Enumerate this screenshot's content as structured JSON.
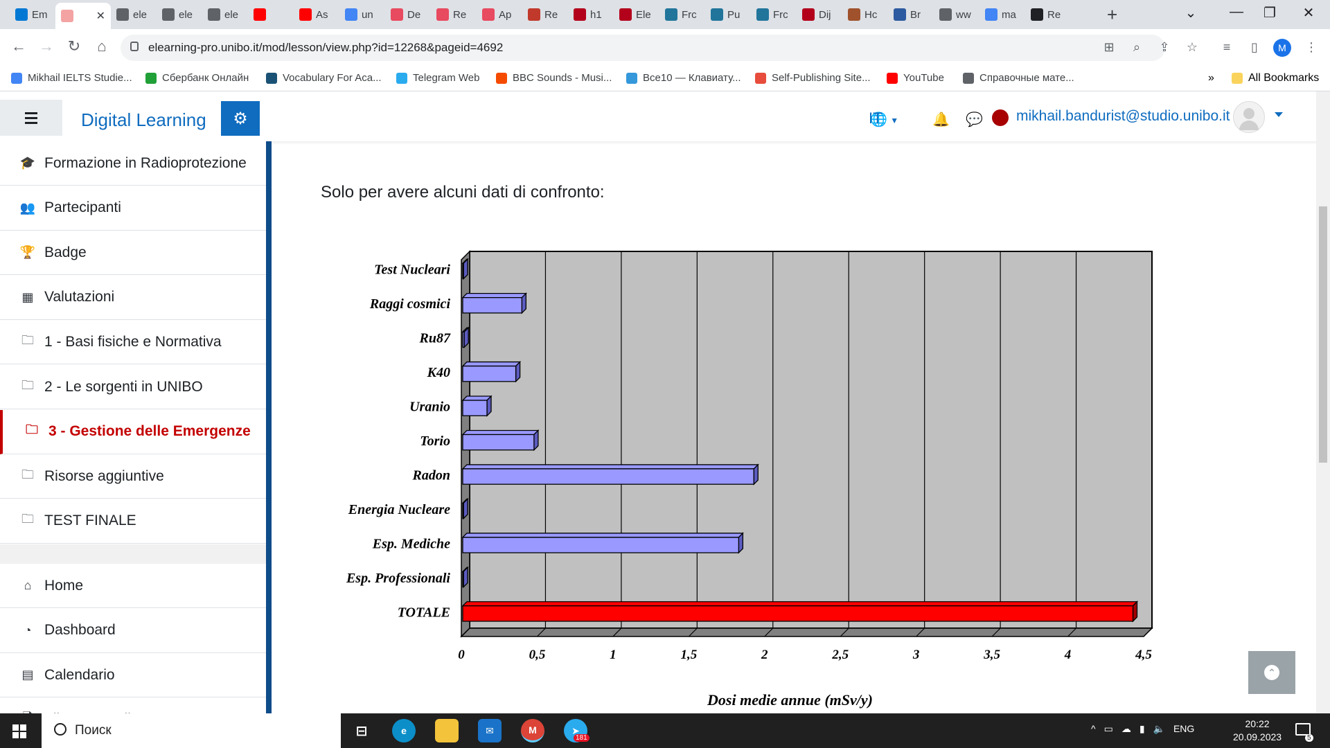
{
  "browser": {
    "tabs": [
      {
        "label": "Em",
        "icon": "outlook-icon",
        "color": "#0078d4"
      },
      {
        "label": "",
        "icon": "app-icon",
        "color": "#f4a3a3",
        "active": true
      },
      {
        "label": "ele",
        "icon": "globe-icon",
        "color": "#5f6368"
      },
      {
        "label": "ele",
        "icon": "globe-icon",
        "color": "#5f6368"
      },
      {
        "label": "ele",
        "icon": "globe-icon",
        "color": "#5f6368"
      },
      {
        "label": "",
        "icon": "youtube-icon",
        "color": "#ff0000"
      },
      {
        "label": "As",
        "icon": "youtube-icon",
        "color": "#ff0000"
      },
      {
        "label": "un",
        "icon": "google-icon",
        "color": "#4285f4"
      },
      {
        "label": "De",
        "icon": "app-icon",
        "color": "#e84a5f"
      },
      {
        "label": "Re",
        "icon": "app-icon",
        "color": "#e84a5f"
      },
      {
        "label": "Ap",
        "icon": "app-icon",
        "color": "#e84a5f"
      },
      {
        "label": "Re",
        "icon": "app-icon",
        "color": "#c0392b"
      },
      {
        "label": "h1",
        "icon": "unibo-icon",
        "color": "#b3001b"
      },
      {
        "label": "Ele",
        "icon": "unibo-icon",
        "color": "#b3001b"
      },
      {
        "label": "Frc",
        "icon": "wordpress-icon",
        "color": "#21759b"
      },
      {
        "label": "Pu",
        "icon": "wordpress-icon",
        "color": "#21759b"
      },
      {
        "label": "Frc",
        "icon": "wordpress-icon",
        "color": "#21759b"
      },
      {
        "label": "Dij",
        "icon": "unibo-icon",
        "color": "#b3001b"
      },
      {
        "label": "Hc",
        "icon": "app-icon",
        "color": "#a0522d"
      },
      {
        "label": "Br",
        "icon": "app-icon",
        "color": "#2c5aa0"
      },
      {
        "label": "ww",
        "icon": "globe-icon",
        "color": "#5f6368"
      },
      {
        "label": "ma",
        "icon": "google-icon",
        "color": "#4285f4"
      },
      {
        "label": "Re",
        "icon": "app-icon",
        "color": "#202124"
      }
    ],
    "url": "elearning-pro.unibo.it/mod/lesson/view.php?id=12268&pageid=4692",
    "profile_initial": "M",
    "bookmarks": [
      {
        "label": "Mikhail IELTS Studie...",
        "color": "#4285f4"
      },
      {
        "label": "Сбербанк Онлайн",
        "color": "#21a038"
      },
      {
        "label": "Vocabulary For Aca...",
        "color": "#1a5276"
      },
      {
        "label": "Telegram Web",
        "color": "#2aabee"
      },
      {
        "label": "BBC Sounds - Musi...",
        "color": "#f54b00"
      },
      {
        "label": "Все10 — Клавиату...",
        "color": "#3498db"
      },
      {
        "label": "Self-Publishing Site...",
        "color": "#e74c3c"
      },
      {
        "label": "YouTube",
        "color": "#ff0000"
      },
      {
        "label": "Справочные мате...",
        "color": "#5f6368"
      }
    ],
    "bookmarks_overflow": "»",
    "all_bookmarks": "All Bookmarks"
  },
  "header": {
    "site_name": "Digital Learning",
    "language": "IT",
    "user_email": "mikhail.bandurist@studio.unibo.it"
  },
  "sidebar": {
    "items": [
      {
        "label": "Formazione in Radioprotezione",
        "icon": "graduation-cap-icon",
        "glyph": "🎓"
      },
      {
        "label": "Partecipanti",
        "icon": "users-icon",
        "glyph": "👥"
      },
      {
        "label": "Badge",
        "icon": "trophy-icon",
        "glyph": "🏆"
      },
      {
        "label": "Valutazioni",
        "icon": "table-icon",
        "glyph": "▦"
      },
      {
        "label": "1 - Basi fisiche e Normativa",
        "icon": "folder-icon",
        "glyph": "🗀"
      },
      {
        "label": "2 - Le sorgenti in UNIBO",
        "icon": "folder-icon",
        "glyph": "🗀"
      },
      {
        "label": "3 - Gestione delle Emergenze",
        "icon": "folder-icon",
        "glyph": "🗀",
        "active": true
      },
      {
        "label": "Risorse aggiuntive",
        "icon": "folder-icon",
        "glyph": "🗀"
      },
      {
        "label": "TEST FINALE",
        "icon": "folder-icon",
        "glyph": "🗀"
      }
    ],
    "items2": [
      {
        "label": "Home",
        "icon": "home-icon",
        "glyph": "⌂"
      },
      {
        "label": "Dashboard",
        "icon": "dashboard-icon",
        "glyph": "◔"
      },
      {
        "label": "Calendario",
        "icon": "calendar-icon",
        "glyph": "▤"
      },
      {
        "label": "File personali",
        "icon": "file-icon",
        "glyph": "🗋"
      }
    ]
  },
  "main": {
    "intro": "Solo per avere alcuni dati di confronto:"
  },
  "chart_data": {
    "type": "bar",
    "orientation": "horizontal",
    "categories": [
      "Test Nucleari",
      "Raggi cosmici",
      "Ru87",
      "K40",
      "Uranio",
      "Torio",
      "Radon",
      "Energia Nucleare",
      "Esp. Mediche",
      "Esp. Professionali",
      "TOTALE"
    ],
    "values": [
      0.005,
      0.39,
      0.01,
      0.35,
      0.16,
      0.47,
      1.92,
      0.005,
      1.82,
      0.005,
      4.42
    ],
    "bar_colors": [
      "#9999ff",
      "#9999ff",
      "#9999ff",
      "#9999ff",
      "#9999ff",
      "#9999ff",
      "#9999ff",
      "#9999ff",
      "#9999ff",
      "#9999ff",
      "#ff0000"
    ],
    "xticks": [
      "0",
      "0,5",
      "1",
      "1,5",
      "2",
      "2,5",
      "3",
      "3,5",
      "4",
      "4,5"
    ],
    "xlim": [
      0,
      4.5
    ],
    "xlabel": "Dosi medie annue (mSv/y)",
    "title": "",
    "grid": true,
    "background": "#c0c0c0"
  },
  "taskbar": {
    "search_placeholder": "Поиск",
    "language": "ENG",
    "time": "20:22",
    "date": "20.09.2023",
    "telegram_badge": "181",
    "notif_count": "5"
  }
}
